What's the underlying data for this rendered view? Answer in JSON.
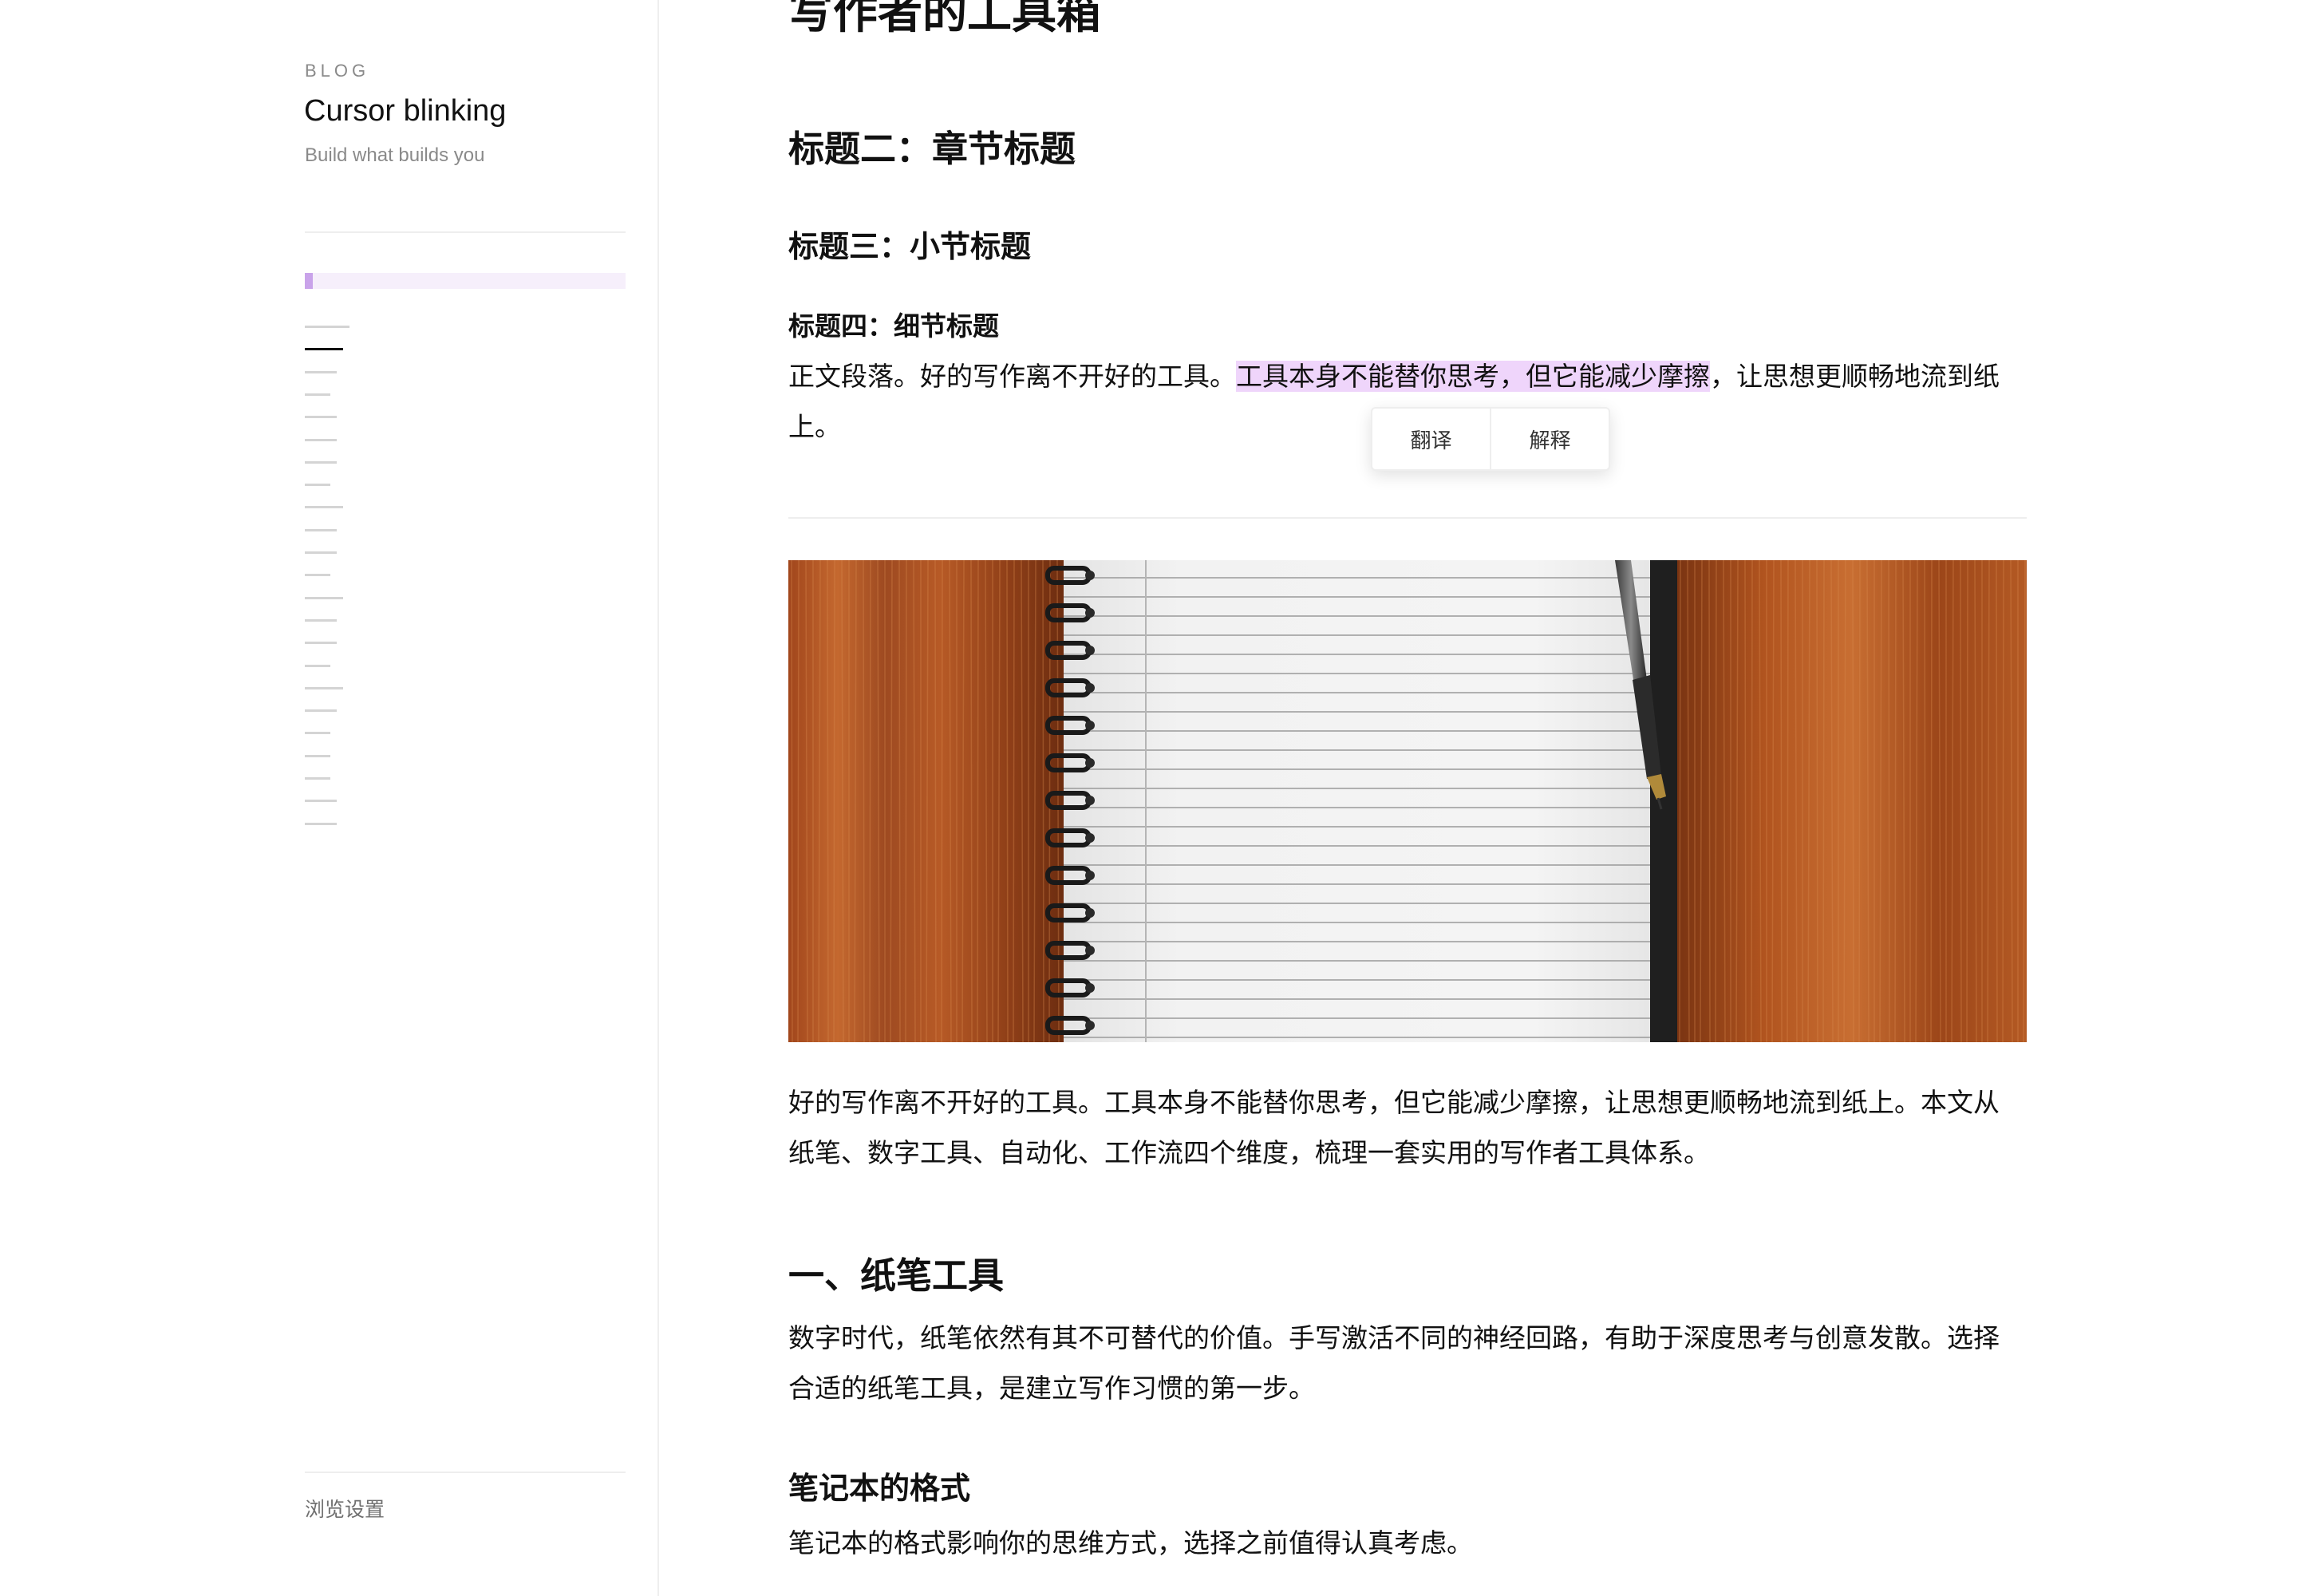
{
  "sidebar": {
    "blog_label": "BLOG",
    "site_title": "Cursor blinking",
    "tagline": "Build what builds you",
    "reading_progress": 0.02,
    "toc_item_count": 23,
    "toc_active_index": 1,
    "settings_label": "浏览设置"
  },
  "article": {
    "title": "写作者的工具箱",
    "heading2": "标题二：章节标题",
    "heading3": "标题三：小节标题",
    "heading4": "标题四：细节标题",
    "body_paragraph": {
      "before": "正文段落。好的写作离不开好的工具。",
      "highlighted": "工具本身不能替你思考，但它能减少摩擦",
      "after": "，让思想更顺畅地流到纸上。"
    },
    "selection_popup": {
      "translate_label": "翻译",
      "explain_label": "解释"
    },
    "intro_paragraph": "好的写作离不开好的工具。工具本身不能替你思考，但它能减少摩擦，让思想更顺畅地流到纸上。本文从纸笔、数字工具、自动化、工作流四个维度，梳理一套实用的写作者工具体系。",
    "section1_title": "一、纸笔工具",
    "section1_paragraph": "数字时代，纸笔依然有其不可替代的价值。手写激活不同的神经回路，有助于深度思考与创意发散。选择合适的纸笔工具，是建立写作习惯的第一步。",
    "subsection_title": "笔记本的格式",
    "subsection_paragraph": "笔记本的格式影响你的思维方式，选择之前值得认真考虑。"
  },
  "colors": {
    "highlight": "#efd5fb",
    "progress_fill": "#c9a3ea",
    "progress_track": "#f6effb"
  }
}
